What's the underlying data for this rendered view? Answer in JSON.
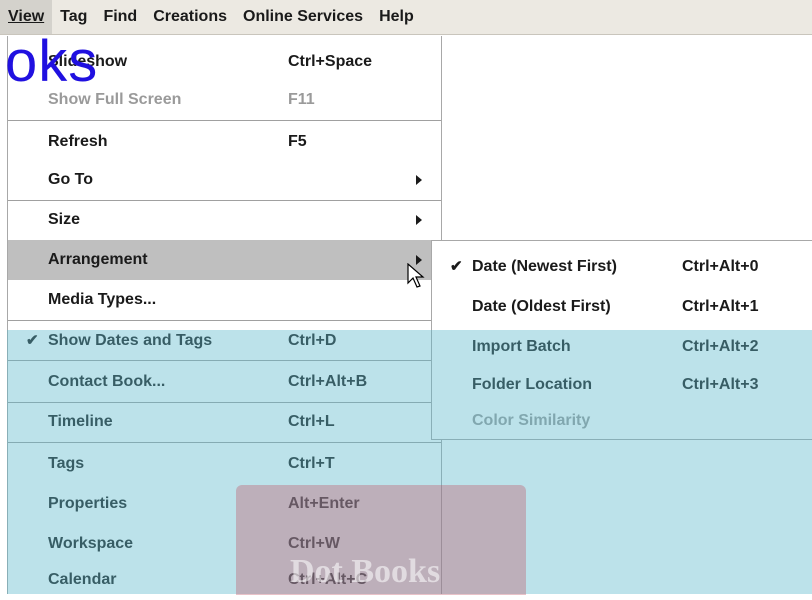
{
  "menubar": {
    "items": [
      {
        "label": "View"
      },
      {
        "label": "Tag"
      },
      {
        "label": "Find"
      },
      {
        "label": "Creations"
      },
      {
        "label": "Online Services"
      },
      {
        "label": "Help"
      }
    ]
  },
  "view_menu": {
    "items": [
      {
        "label": "Slideshow",
        "shortcut": "Ctrl+Space"
      },
      {
        "label": "Show Full Screen",
        "shortcut": "F11",
        "disabled": true
      },
      {
        "label": "Refresh",
        "shortcut": "F5"
      },
      {
        "label": "Go To",
        "submenu": true
      },
      {
        "label": "Size",
        "submenu": true
      },
      {
        "label": "Arrangement",
        "submenu": true,
        "highlighted": true
      },
      {
        "label": "Media Types..."
      },
      {
        "label": "Show Dates and Tags",
        "shortcut": "Ctrl+D",
        "checked": true
      },
      {
        "label": "Contact Book...",
        "shortcut": "Ctrl+Alt+B"
      },
      {
        "label": "Timeline",
        "shortcut": "Ctrl+L"
      },
      {
        "label": "Tags",
        "shortcut": "Ctrl+T"
      },
      {
        "label": "Properties",
        "shortcut": "Alt+Enter"
      },
      {
        "label": "Workspace",
        "shortcut": "Ctrl+W"
      },
      {
        "label": "Calendar",
        "shortcut": "Ctrl+Alt+C"
      }
    ]
  },
  "arrangement_submenu": {
    "items": [
      {
        "label": "Date (Newest First)",
        "shortcut": "Ctrl+Alt+0",
        "checked": true
      },
      {
        "label": "Date (Oldest First)",
        "shortcut": "Ctrl+Alt+1"
      },
      {
        "label": "Import Batch",
        "shortcut": "Ctrl+Alt+2"
      },
      {
        "label": "Folder Location",
        "shortcut": "Ctrl+Alt+3"
      },
      {
        "label": "Color Similarity",
        "disabled": true
      }
    ]
  },
  "icons": {
    "check": "✔",
    "cursor": "arrow-pointer-icon"
  },
  "watermark": {
    "text": "oks",
    "inner_text": "Dot Books"
  },
  "colors": {
    "highlight": "#bfbfbf",
    "disabled_text": "#9a9a9a",
    "watermark_band": "#5fb9cd",
    "watermark_text": "#2010e0"
  }
}
